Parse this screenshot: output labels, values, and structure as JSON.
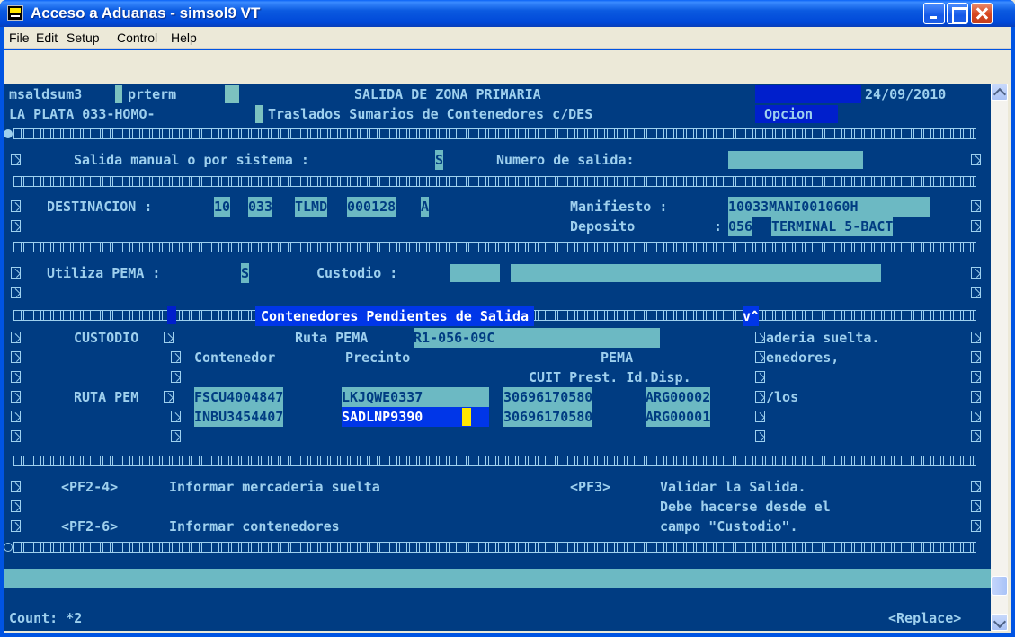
{
  "window": {
    "title": "Acceso a Aduanas - simsol9 VT"
  },
  "menu": [
    "File",
    "Edit",
    "Setup",
    "Control",
    "Help"
  ],
  "header": {
    "program": "msaldsum3",
    "terminal": "prterm",
    "title": "SALIDA DE ZONA PRIMARIA",
    "date": "24/09/2010",
    "location": "LA PLATA 033-HOMO-",
    "subtitle": "Traslados Sumarios de Contenedores c/DES",
    "opcion_label": "Opcion"
  },
  "salida": {
    "label": "Salida manual o por sistema :",
    "value": "S",
    "numero_label": "Numero de salida:",
    "numero_value": ""
  },
  "destinacion": {
    "label": "DESTINACION :",
    "parts": [
      "10",
      "033",
      "TLMD",
      "000128",
      "A"
    ],
    "manifiesto_label": "Manifiesto :",
    "manifiesto_value": "10033MANI001060H",
    "deposito_label": "Deposito",
    "deposito_sep": ":",
    "deposito_code": "056",
    "deposito_name": "TERMINAL 5-BACT"
  },
  "pema": {
    "label": "Utiliza PEMA :",
    "value": "S",
    "custodio_label": "Custodio :",
    "custodio_code": "",
    "custodio_name": ""
  },
  "popup": {
    "title": "Contenedores Pendientes de Salida",
    "scroll_hint": "v^",
    "custodio_label": "CUSTODIO",
    "ruta_label": "Ruta PEMA",
    "ruta_value": "R1-056-09C",
    "col_contenedor": "Contenedor",
    "col_precinto": "Precinto",
    "col_pema": "PEMA",
    "col_cuit": "CUIT Prest. Id.Disp.",
    "ruta_pem_label": "RUTA PEM",
    "rows": [
      {
        "contenedor": "FSCU4004847",
        "precinto": "LKJQWE0337",
        "cuit": "30696170580",
        "id_disp": "ARG00002"
      },
      {
        "contenedor": "INBU3454407",
        "precinto": "SADLNP9390",
        "cuit": "30696170580",
        "id_disp": "ARG00001"
      }
    ],
    "right_text": [
      "aderia suelta.",
      "enedores,",
      "",
      "/los"
    ]
  },
  "footer": {
    "pf24": "<PF2-4>",
    "pf24_text": "Informar mercaderia suelta",
    "pf3": "<PF3>",
    "pf3_text": "Validar la Salida.",
    "pf3_line2": "Debe hacerse desde el",
    "pf3_line3": "campo \"Custodio\".",
    "pf26": "<PF2-6>",
    "pf26_text": "Informar contenedores"
  },
  "status": {
    "count": "Count: *2",
    "mode": "<Replace>"
  },
  "colors": {
    "terminal_bg": "#003c82",
    "text": "#9ed0ee",
    "field": "#6cb9c3",
    "highlight": "#0036e8",
    "cursor": "#ffe600"
  }
}
